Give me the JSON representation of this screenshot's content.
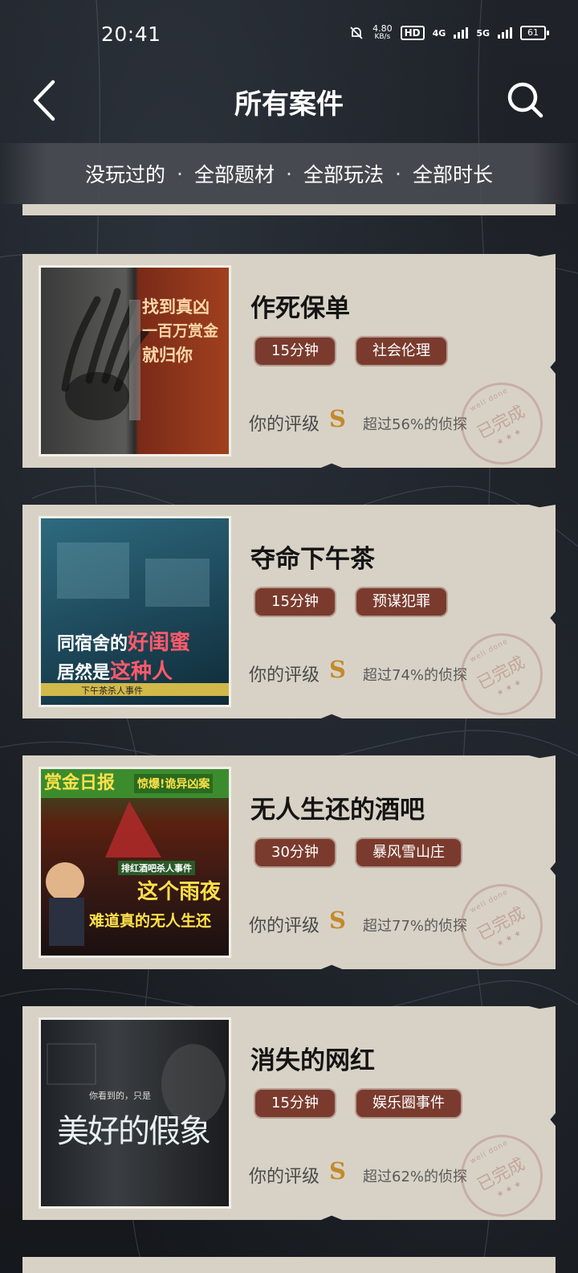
{
  "status_bar": {
    "time": "20:41",
    "net_speed": "4.80",
    "net_unit": "KB/s",
    "hd_label": "HD",
    "sim1": "4G",
    "sim2": "5G",
    "battery": "61"
  },
  "header": {
    "title": "所有案件",
    "back_icon": "chevron-left-icon",
    "search_icon": "search-icon"
  },
  "filters": [
    "没玩过的",
    "全部题材",
    "全部玩法",
    "全部时长"
  ],
  "filter_separator": "·",
  "cases": [
    {
      "title": "作死保单",
      "duration": "15分钟",
      "genre": "社会伦理",
      "rating_label": "你的评级",
      "rating": "S",
      "percent_text": "超过56%的侦探",
      "stamp_text": "已完成",
      "stamp_sub": "well done",
      "thumb_text": [
        "找到真凶",
        "一百万赏金",
        "就归你"
      ]
    },
    {
      "title": "夺命下午茶",
      "duration": "15分钟",
      "genre": "预谋犯罪",
      "rating_label": "你的评级",
      "rating": "S",
      "percent_text": "超过74%的侦探",
      "stamp_text": "已完成",
      "stamp_sub": "well done",
      "thumb_text": [
        "同宿舍的",
        "好闺蜜",
        "居然是",
        "这种人",
        "下午茶杀人事件"
      ]
    },
    {
      "title": "无人生还的酒吧",
      "duration": "30分钟",
      "genre": "暴风雪山庄",
      "rating_label": "你的评级",
      "rating": "S",
      "percent_text": "超过77%的侦探",
      "stamp_text": "已完成",
      "stamp_sub": "well done",
      "thumb_text": [
        "赏金日报",
        "惊爆!诡异凶案",
        "这个雨夜",
        "难道真的无人生还",
        "排红酒吧杀人事件"
      ]
    },
    {
      "title": "消失的网红",
      "duration": "15分钟",
      "genre": "娱乐圈事件",
      "rating_label": "你的评级",
      "rating": "S",
      "percent_text": "超过62%的侦探",
      "stamp_text": "已完成",
      "stamp_sub": "well done",
      "thumb_text": [
        "你看到的，只是",
        "美好的假象"
      ]
    }
  ]
}
